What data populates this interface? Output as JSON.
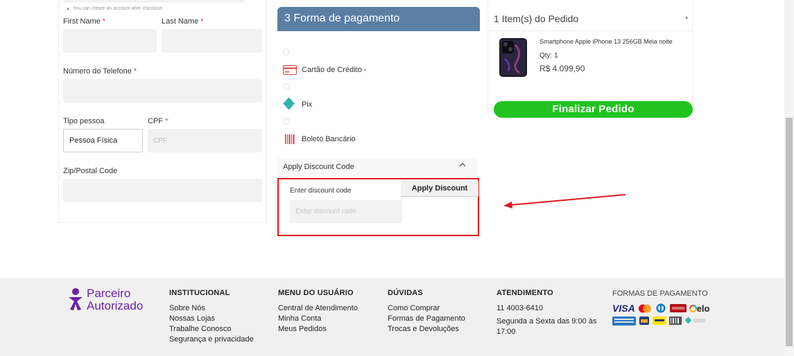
{
  "shipping_form": {
    "hint": "You can create an account after checkout.",
    "first_name_label": "First Name",
    "last_name_label": "Last Name",
    "phone_label": "Número do Telefone",
    "person_type_label": "Tipo pessoa",
    "person_type_value": "Pessoa Física",
    "cpf_label": "CPF",
    "cpf_placeholder": "CPF",
    "zip_label": "Zip/Postal Code",
    "required_mark": "*"
  },
  "payment": {
    "header": "3 Forma de pagamento",
    "options": [
      {
        "label": "Cartão de Crédito -",
        "icon": "credit-card-icon"
      },
      {
        "label": "Pix",
        "icon": "pix-icon"
      },
      {
        "label": "Boleto Bancário",
        "icon": "barcode-icon"
      }
    ],
    "discount_toggle_label": "Apply Discount Code",
    "discount_field_label": "Enter discount code",
    "discount_placeholder": "Enter discount code",
    "apply_button": "Apply Discount",
    "highlight_color": "#e0191f"
  },
  "order_summary": {
    "title": "1 Item(s) do Pedido",
    "product_name": "Smartphone Apple iPhone 13 256GB Meia noite",
    "qty": "Qty: 1",
    "price": "R$ 4.099,90",
    "finalize_button": "Finalizar Pedido",
    "button_color": "#21c41f"
  },
  "footer": {
    "logo_line1": "Parceiro",
    "logo_line2": "Autorizado",
    "institucional": {
      "title": "INSTITUCIONAL",
      "items": [
        "Sobre Nós",
        "Nossas Lojas",
        "Trabalhe Conosco",
        "Segurança e privacidade"
      ]
    },
    "menu_usuario": {
      "title": "MENU DO USUÁRIO",
      "items": [
        "Central de Atendimento",
        "Minha Conta",
        "Meus Pedidos"
      ]
    },
    "duvidas": {
      "title": "DÚVIDAS",
      "items": [
        "Como Comprar",
        "Formas de Pagamento",
        "Trocas e Devoluções"
      ]
    },
    "atendimento": {
      "title": "ATENDIMENTO",
      "phone": "11 4003-6410",
      "hours_line1": "Segunda a Sexta das 9:00 às",
      "hours_line2": "17:00"
    },
    "formas_pagamento_title": "FORMAS DE PAGAMENTO",
    "payment_logos": {
      "visa": "VISA",
      "elo": "elo",
      "icons": [
        "visa-logo-icon",
        "mastercard-logo-icon",
        "diners-logo-icon",
        "hipercard-logo-icon",
        "elo-logo-icon",
        "amex-logo-icon",
        "hiper-logo-icon",
        "mercadopago-logo-icon",
        "boleto-logo-icon",
        "pix-logo-icon"
      ]
    }
  }
}
